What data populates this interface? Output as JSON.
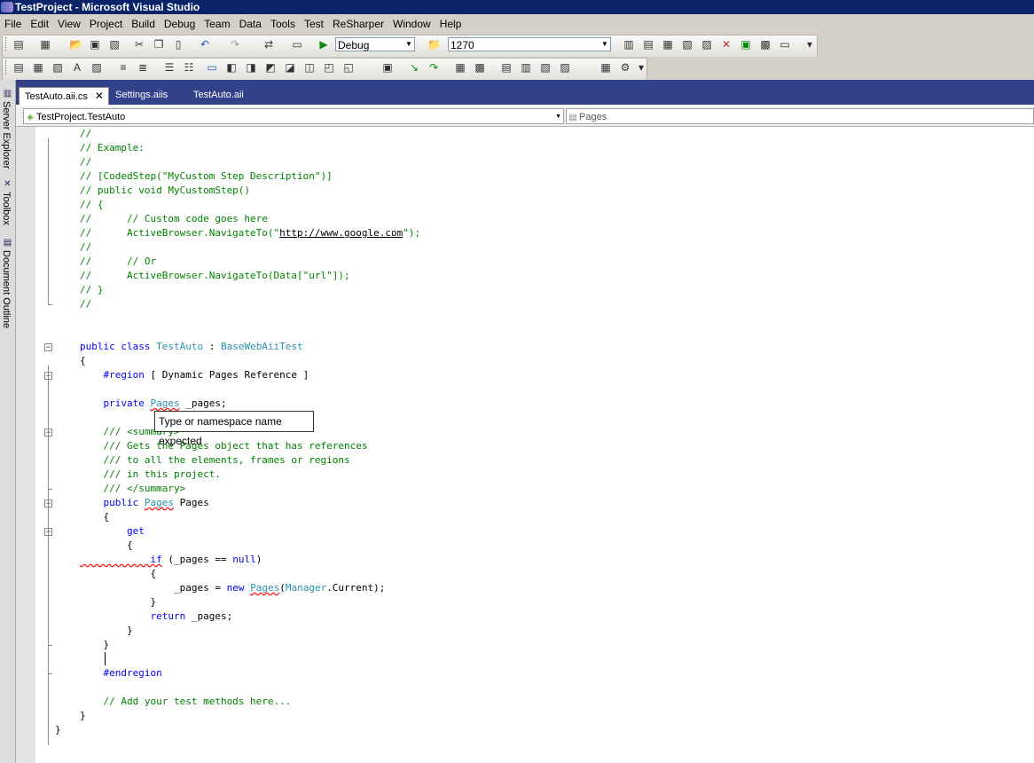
{
  "window": {
    "title": "TestProject - Microsoft Visual Studio"
  },
  "menu": [
    "File",
    "Edit",
    "View",
    "Project",
    "Build",
    "Debug",
    "Team",
    "Data",
    "Tools",
    "Test",
    "ReSharper",
    "Window",
    "Help"
  ],
  "toolbar": {
    "configuration": "Debug",
    "target": "1270"
  },
  "side_tabs": [
    "Server Explorer",
    "Toolbox",
    "Document Outline"
  ],
  "tabs": [
    {
      "label": "TestAuto.aii.cs",
      "active": true,
      "close": "✕"
    },
    {
      "label": "Settings.aiis",
      "active": false
    },
    {
      "label": "TestAuto.aii",
      "active": false
    }
  ],
  "nav": {
    "type_combo": "TestProject.TestAuto",
    "member_combo": "Pages"
  },
  "code": [
    [
      [
        "c",
        "//"
      ]
    ],
    [
      [
        "c",
        "// Example:"
      ]
    ],
    [
      [
        "c",
        "//"
      ]
    ],
    [
      [
        "c",
        "// [CodedStep(\"MyCustom Step Description\")]"
      ]
    ],
    [
      [
        "c",
        "// public void MyCustomStep()"
      ]
    ],
    [
      [
        "c",
        "// {"
      ]
    ],
    [
      [
        "c",
        "//      // Custom code goes here"
      ]
    ],
    [
      [
        "c",
        "//      ActiveBrowser.NavigateTo(\""
      ],
      [
        "u",
        "http://www.google.com"
      ],
      [
        "c",
        "\");"
      ]
    ],
    [
      [
        "c",
        "//"
      ]
    ],
    [
      [
        "c",
        "//      // Or"
      ]
    ],
    [
      [
        "c",
        "//      ActiveBrowser.NavigateTo(Data[\"url\"]);"
      ]
    ],
    [
      [
        "c",
        "// }"
      ]
    ],
    [
      [
        "c",
        "//"
      ]
    ],
    [],
    [],
    [
      [
        "k",
        "public class "
      ],
      [
        "t",
        "TestAuto"
      ],
      [
        "p",
        " : "
      ],
      [
        "t",
        "BaseWebAiiTest"
      ]
    ],
    [
      [
        "p",
        "{"
      ]
    ],
    [
      [
        "k",
        "    #region "
      ],
      [
        "p",
        "[ Dynamic Pages Reference ]"
      ]
    ],
    [],
    [
      [
        "k",
        "    private "
      ],
      [
        "tsq",
        "Pages"
      ],
      [
        "p",
        " _pages;"
      ]
    ],
    [],
    [
      [
        "c",
        "    /// <summary>"
      ]
    ],
    [
      [
        "c",
        "    /// Gets the Pages object that has references"
      ]
    ],
    [
      [
        "c",
        "    /// to all the elements, frames or regions"
      ]
    ],
    [
      [
        "c",
        "    /// in this project."
      ]
    ],
    [
      [
        "c",
        "    /// </summary>"
      ]
    ],
    [
      [
        "k",
        "    public "
      ],
      [
        "tsq",
        "Pages"
      ],
      [
        "p",
        " Pages"
      ]
    ],
    [
      [
        "p",
        "    {"
      ]
    ],
    [
      [
        "k",
        "        get"
      ]
    ],
    [
      [
        "p",
        "        {"
      ]
    ],
    [
      [
        "ksq",
        "            if"
      ],
      [
        "p",
        " (_pages == "
      ],
      [
        "k",
        "null"
      ],
      [
        "p",
        ")"
      ]
    ],
    [
      [
        "p",
        "            {"
      ]
    ],
    [
      [
        "p",
        "                _pages = "
      ],
      [
        "k",
        "new "
      ],
      [
        "tsq",
        "Pages"
      ],
      [
        "p",
        "("
      ],
      [
        "t",
        "Manager"
      ],
      [
        "p",
        ".Current);"
      ]
    ],
    [
      [
        "p",
        "            }"
      ]
    ],
    [
      [
        "k",
        "            return"
      ],
      [
        "p",
        " _pages;"
      ]
    ],
    [
      [
        "p",
        "        }"
      ]
    ],
    [
      [
        "p",
        "    }"
      ]
    ],
    [],
    [
      [
        "k",
        "    #endregion"
      ]
    ],
    [],
    [
      [
        "c",
        "    // Add your test methods here..."
      ]
    ],
    [
      [
        "p",
        "}"
      ]
    ]
  ],
  "last_line": "}",
  "tooltip": "Type or namespace name expected"
}
